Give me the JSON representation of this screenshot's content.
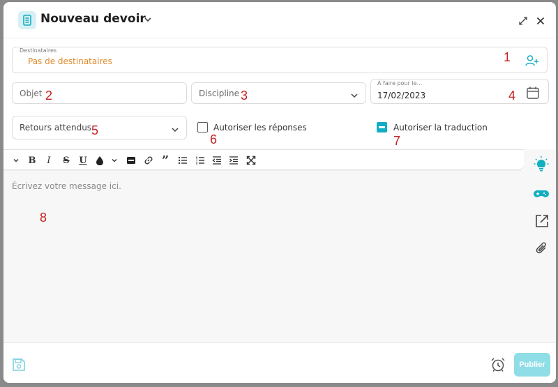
{
  "header": {
    "title": "Nouveau devoir"
  },
  "recipients": {
    "label": "Destinataires",
    "value": "Pas de destinataires"
  },
  "subject": {
    "placeholder": "Objet"
  },
  "discipline": {
    "placeholder": "Discipline"
  },
  "due_date": {
    "label": "À faire pour le...",
    "value": "17/02/2023"
  },
  "expected_returns": {
    "placeholder": "Retours attendus"
  },
  "allow_replies": {
    "label": "Autoriser les réponses",
    "checked": false
  },
  "allow_translation": {
    "label": "Autoriser la traduction",
    "checked": true
  },
  "editor": {
    "placeholder": "Écrivez votre message ici."
  },
  "footer": {
    "publish_label": "Publier"
  },
  "annotations": [
    "1",
    "2",
    "3",
    "4",
    "5",
    "6",
    "7",
    "8"
  ],
  "colors": {
    "accent": "#12aec2",
    "recipient_value": "#e08a2b",
    "annotation": "#c42121",
    "publish_bg": "#8fdde7"
  },
  "toolbar": [
    "chevron-down-icon",
    "bold-icon",
    "italic-icon",
    "strikethrough-icon",
    "underline-icon",
    "text-color-icon",
    "chevron-down-icon",
    "highlight-icon",
    "link-icon",
    "quote-icon",
    "bullet-list-icon",
    "numbered-list-icon",
    "outdent-icon",
    "indent-icon",
    "fullscreen-icon"
  ]
}
